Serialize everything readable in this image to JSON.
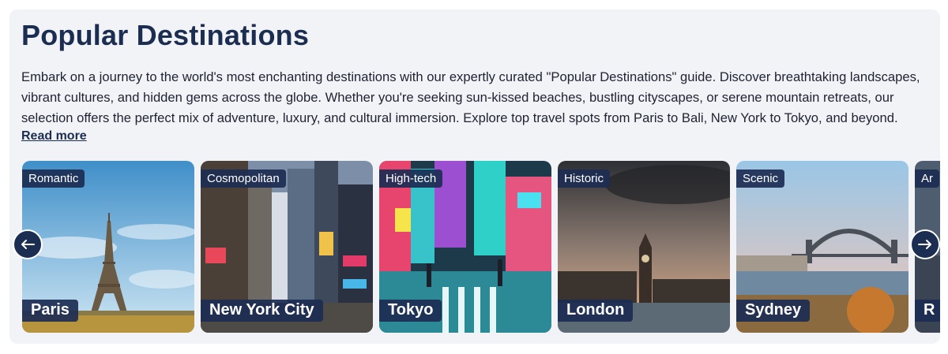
{
  "section": {
    "title": "Popular Destinations",
    "description": "Embark on a journey to the world's most enchanting destinations with our expertly curated \"Popular Destinations\" guide. Discover breathtaking landscapes, vibrant cultures, and hidden gems across the globe. Whether you're seeking sun-kissed beaches, bustling cityscapes, or serene mountain retreats, our selection offers the perfect mix of adventure, luxury, and cultural immersion. Explore top travel spots from Paris to Bali, New York to Tokyo, and beyond.",
    "read_more": "Read more"
  },
  "cards": [
    {
      "tag": "Romantic",
      "name": "Paris",
      "icon": "eiffel-tower"
    },
    {
      "tag": "Cosmopolitan",
      "name": "New York City",
      "icon": "skyscrapers"
    },
    {
      "tag": "High-tech",
      "name": "Tokyo",
      "icon": "neon-street"
    },
    {
      "tag": "Historic",
      "name": "London",
      "icon": "big-ben"
    },
    {
      "tag": "Scenic",
      "name": "Sydney",
      "icon": "harbour-bridge"
    },
    {
      "tag": "Ar",
      "name": "R",
      "icon": "partial-card"
    }
  ],
  "nav": {
    "prev_icon": "arrow-left",
    "next_icon": "arrow-right"
  }
}
